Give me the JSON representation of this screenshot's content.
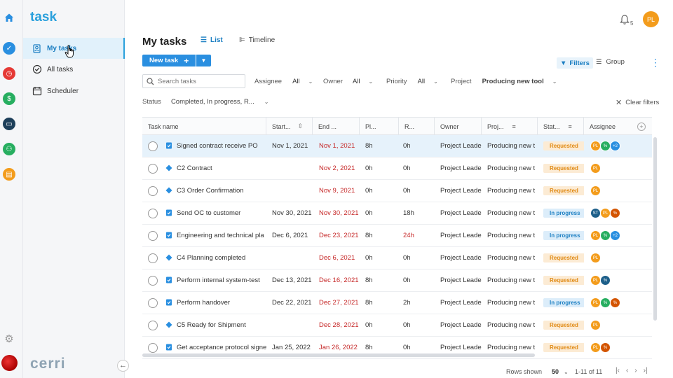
{
  "app": {
    "logo": "task",
    "brand": "cerri"
  },
  "colors": {
    "accent": "#2a8fe0",
    "requested": "#e08a14",
    "in_progress": "#1a7ec2",
    "overdue": "#c62828"
  },
  "rail_icons": [
    "home-icon",
    "check-icon",
    "timer-icon",
    "money-icon",
    "folder-icon",
    "people-icon",
    "briefcase-icon",
    "gear-icon"
  ],
  "sidebar": {
    "items": [
      {
        "label": "My tasks",
        "icon": "user-task-icon",
        "active": true
      },
      {
        "label": "All tasks",
        "icon": "check-circle-icon",
        "active": false
      },
      {
        "label": "Scheduler",
        "icon": "calendar-icon",
        "active": false
      }
    ]
  },
  "header": {
    "notifications_count": "5",
    "user_initials": "PL"
  },
  "main": {
    "title": "My tasks",
    "tabs": [
      {
        "label": "List",
        "active": true
      },
      {
        "label": "Timeline",
        "active": false
      }
    ],
    "new_task_label": "New task",
    "filters_label": "Filters",
    "group_label": "Group",
    "search_placeholder": "Search tasks",
    "filters": {
      "assignee": {
        "label": "Assignee",
        "value": "All"
      },
      "owner": {
        "label": "Owner",
        "value": "All"
      },
      "priority": {
        "label": "Priority",
        "value": "All"
      },
      "project": {
        "label": "Project",
        "value": "Producing new tool"
      },
      "status": {
        "label": "Status",
        "value": "Completed, In progress, R..."
      }
    },
    "clear_filters_label": "Clear filters"
  },
  "table": {
    "columns": [
      "Task name",
      "Start...",
      "End ...",
      "Pl...",
      "R...",
      "Owner",
      "Proj...",
      "Stat...",
      "Assignee"
    ],
    "rows": [
      {
        "name": "Signed contract receive PO",
        "type": "task",
        "start": "Nov 1, 2021",
        "end": "Nov 1, 2021",
        "planned": "8h",
        "remaining": "0h",
        "remaining_red": false,
        "owner": "Project Leade",
        "project": "Producing new t",
        "status": "Requested",
        "assignees": [
          {
            "i": "PL",
            "c": "#f39c1c"
          },
          {
            "i": "%",
            "c": "#27ae60"
          },
          {
            "i": "+2",
            "c": "#2a8fe0"
          }
        ],
        "selected": true
      },
      {
        "name": "C2 Contract",
        "type": "milestone",
        "start": "",
        "end": "Nov 2, 2021",
        "planned": "0h",
        "remaining": "0h",
        "remaining_red": false,
        "owner": "Project Leade",
        "project": "Producing new t",
        "status": "Requested",
        "assignees": [
          {
            "i": "PL",
            "c": "#f39c1c"
          }
        ],
        "selected": false
      },
      {
        "name": "C3 Order Confirmation",
        "type": "milestone",
        "start": "",
        "end": "Nov 9, 2021",
        "planned": "0h",
        "remaining": "0h",
        "remaining_red": false,
        "owner": "Project Leade",
        "project": "Producing new t",
        "status": "Requested",
        "assignees": [
          {
            "i": "PL",
            "c": "#f39c1c"
          }
        ],
        "selected": false
      },
      {
        "name": "Send OC to customer",
        "type": "task",
        "start": "Nov 30, 2021",
        "end": "Nov 30, 2021",
        "planned": "0h",
        "remaining": "18h",
        "remaining_red": false,
        "owner": "Project Leade",
        "project": "Producing new t",
        "status": "In progress",
        "assignees": [
          {
            "i": "ST",
            "c": "#1d5f8a"
          },
          {
            "i": "PL",
            "c": "#f39c1c"
          },
          {
            "i": "%",
            "c": "#d35400"
          }
        ],
        "selected": false
      },
      {
        "name": "Engineering and technical pla",
        "type": "task",
        "start": "Dec 6, 2021",
        "end": "Dec 23, 2021",
        "planned": "8h",
        "remaining": "24h",
        "remaining_red": true,
        "owner": "Project Leade",
        "project": "Producing new t",
        "status": "In progress",
        "assignees": [
          {
            "i": "PL",
            "c": "#f39c1c"
          },
          {
            "i": "%",
            "c": "#27ae60"
          },
          {
            "i": "+2",
            "c": "#2a8fe0"
          }
        ],
        "selected": false
      },
      {
        "name": "C4 Planning completed",
        "type": "milestone",
        "start": "",
        "end": "Dec 6, 2021",
        "planned": "0h",
        "remaining": "0h",
        "remaining_red": false,
        "owner": "Project Leade",
        "project": "Producing new t",
        "status": "Requested",
        "assignees": [
          {
            "i": "PL",
            "c": "#f39c1c"
          }
        ],
        "selected": false
      },
      {
        "name": "Perform internal system-test",
        "type": "task",
        "start": "Dec 13, 2021",
        "end": "Dec 16, 2021",
        "planned": "8h",
        "remaining": "0h",
        "remaining_red": false,
        "owner": "Project Leade",
        "project": "Producing new t",
        "status": "Requested",
        "assignees": [
          {
            "i": "PL",
            "c": "#f39c1c"
          },
          {
            "i": "%",
            "c": "#1d5f8a"
          }
        ],
        "selected": false
      },
      {
        "name": "Perform handover",
        "type": "task",
        "start": "Dec 22, 2021",
        "end": "Dec 27, 2021",
        "planned": "8h",
        "remaining": "2h",
        "remaining_red": false,
        "owner": "Project Leade",
        "project": "Producing new t",
        "status": "In progress",
        "assignees": [
          {
            "i": "PL",
            "c": "#f39c1c"
          },
          {
            "i": "%",
            "c": "#27ae60"
          },
          {
            "i": "%",
            "c": "#d35400"
          }
        ],
        "selected": false
      },
      {
        "name": "C5 Ready for Shipment",
        "type": "milestone",
        "start": "",
        "end": "Dec 28, 2021",
        "planned": "0h",
        "remaining": "0h",
        "remaining_red": false,
        "owner": "Project Leade",
        "project": "Producing new t",
        "status": "Requested",
        "assignees": [
          {
            "i": "PL",
            "c": "#f39c1c"
          }
        ],
        "selected": false
      },
      {
        "name": "Get acceptance protocol signe",
        "type": "task",
        "start": "Jan 25, 2022",
        "end": "Jan 26, 2022",
        "planned": "8h",
        "remaining": "0h",
        "remaining_red": false,
        "owner": "Project Leade",
        "project": "Producing new t",
        "status": "Requested",
        "assignees": [
          {
            "i": "PL",
            "c": "#f39c1c"
          },
          {
            "i": "%",
            "c": "#d35400"
          }
        ],
        "selected": false
      }
    ]
  },
  "pager": {
    "rows_label": "Rows shown",
    "rows_value": "50",
    "range": "1-11 of 11"
  }
}
